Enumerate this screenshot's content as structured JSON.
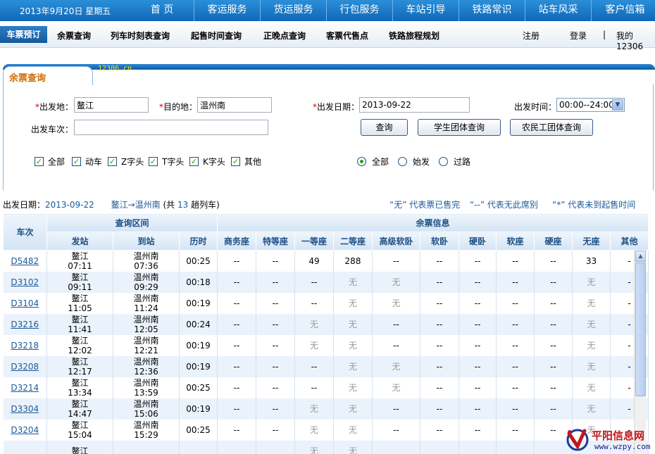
{
  "top": {
    "date": "2013年9月20日  星期五",
    "nav": [
      "首  页",
      "客运服务",
      "货运服务",
      "行包服务",
      "车站引导",
      "铁路常识",
      "站车风采",
      "客户信箱"
    ]
  },
  "subnav": {
    "active": "车票预订",
    "items": [
      "余票查询",
      "列车时刻表查询",
      "起售时间查询",
      "正晚点查询",
      "客票代售点",
      "铁路旅程规划"
    ],
    "register": "注册",
    "login": "登录",
    "sep": "|",
    "my": "我的12306"
  },
  "panel": {
    "title": "余票查询",
    "site": ".12306.cn"
  },
  "form": {
    "from_label": "出发地：",
    "from_value": "鳌江",
    "to_label": "目的地：",
    "to_value": "温州南",
    "date_label": "出发日期：",
    "date_value": "2013-09-22",
    "time_label": "出发时间：",
    "time_value": "00:00--24:00",
    "train_label": "出发车次：",
    "train_value": "",
    "btn_query": "查询",
    "btn_student": "学生团体查询",
    "btn_worker": "农民工团体查询",
    "checks": [
      "全部",
      "动车",
      "Z字头",
      "T字头",
      "K字头",
      "其他"
    ],
    "radios": [
      "全部",
      "始发",
      "过路"
    ]
  },
  "summary": {
    "date_label": "出发日期：",
    "date": "2013-09-22",
    "route": "鳌江→温州南",
    "count_prefix": "(共",
    "count": "13",
    "count_suffix": "趟列车)",
    "legend1": "“无” 代表票已售完",
    "legend2": "“--” 代表无此席别",
    "legend3": "“*” 代表未到起售时间"
  },
  "table": {
    "h_train": "车次",
    "h_interval": "查询区间",
    "h_info": "余票信息",
    "h_from": "发站",
    "h_to": "到站",
    "h_dur": "历时",
    "seats": [
      "商务座",
      "特等座",
      "一等座",
      "二等座",
      "高级软卧",
      "软卧",
      "硬卧",
      "软座",
      "硬座",
      "无座",
      "其他"
    ],
    "rows": [
      {
        "train": "D5482",
        "from": "鳌江",
        "dep": "07:11",
        "to": "温州南",
        "arr": "07:36",
        "dur": "00:25",
        "seats": [
          "--",
          "--",
          "49",
          "288",
          "--",
          "--",
          "--",
          "--",
          "--",
          "33",
          "-"
        ]
      },
      {
        "train": "D3102",
        "from": "鳌江",
        "dep": "09:11",
        "to": "温州南",
        "arr": "09:29",
        "dur": "00:18",
        "seats": [
          "--",
          "--",
          "--",
          "无",
          "无",
          "--",
          "--",
          "--",
          "--",
          "无",
          "-"
        ]
      },
      {
        "train": "D3104",
        "from": "鳌江",
        "dep": "11:05",
        "to": "温州南",
        "arr": "11:24",
        "dur": "00:19",
        "seats": [
          "--",
          "--",
          "--",
          "无",
          "无",
          "--",
          "--",
          "--",
          "--",
          "无",
          "-"
        ]
      },
      {
        "train": "D3216",
        "from": "鳌江",
        "dep": "11:41",
        "to": "温州南",
        "arr": "12:05",
        "dur": "00:24",
        "seats": [
          "--",
          "--",
          "无",
          "无",
          "--",
          "--",
          "--",
          "--",
          "--",
          "无",
          "-"
        ]
      },
      {
        "train": "D3218",
        "from": "鳌江",
        "dep": "12:02",
        "to": "温州南",
        "arr": "12:21",
        "dur": "00:19",
        "seats": [
          "--",
          "--",
          "无",
          "无",
          "--",
          "--",
          "--",
          "--",
          "--",
          "无",
          "-"
        ]
      },
      {
        "train": "D3208",
        "from": "鳌江",
        "dep": "12:17",
        "to": "温州南",
        "arr": "12:36",
        "dur": "00:19",
        "seats": [
          "--",
          "--",
          "--",
          "无",
          "无",
          "--",
          "--",
          "--",
          "--",
          "无",
          "-"
        ]
      },
      {
        "train": "D3214",
        "from": "鳌江",
        "dep": "13:34",
        "to": "温州南",
        "arr": "13:59",
        "dur": "00:25",
        "seats": [
          "--",
          "--",
          "--",
          "无",
          "无",
          "--",
          "--",
          "--",
          "--",
          "无",
          "-"
        ]
      },
      {
        "train": "D3304",
        "from": "鳌江",
        "dep": "14:47",
        "to": "温州南",
        "arr": "15:06",
        "dur": "00:19",
        "seats": [
          "--",
          "--",
          "无",
          "无",
          "--",
          "--",
          "--",
          "--",
          "--",
          "无",
          "-"
        ]
      },
      {
        "train": "D3204",
        "from": "鳌江",
        "dep": "15:04",
        "to": "温州南",
        "arr": "15:29",
        "dur": "00:25",
        "seats": [
          "--",
          "--",
          "无",
          "无",
          "--",
          "--",
          "--",
          "--",
          "--",
          "无",
          "-"
        ]
      },
      {
        "train": "",
        "from": "鳌江",
        "dep": "",
        "to": "",
        "arr": "",
        "dur": "",
        "seats": [
          "",
          "",
          "无",
          "无",
          "",
          "",
          "",
          "",
          "",
          "",
          ""
        ]
      }
    ]
  },
  "watermark": {
    "name": "平阳信息网",
    "url": "www.wzpy.com"
  },
  "colors": {
    "brand_blue": "#0f67b8",
    "link_blue": "#1c5a9a",
    "title_orange": "#d06a00",
    "check_green": "#21a121",
    "star_red": "#dd0000"
  }
}
